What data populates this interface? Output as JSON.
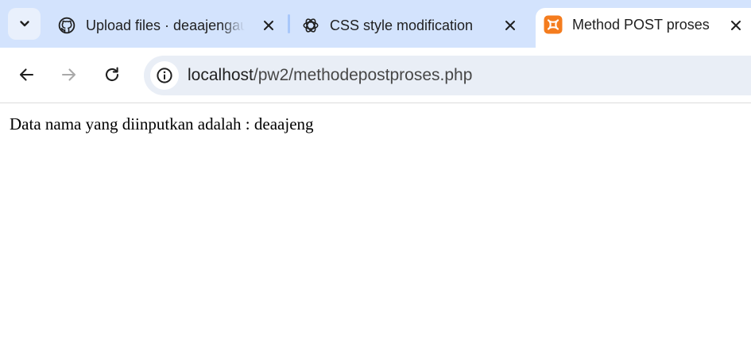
{
  "browser": {
    "tabs": [
      {
        "title": "Upload files · deaajengau",
        "favicon": "github-icon"
      },
      {
        "title": "CSS style modification",
        "favicon": "openai-icon"
      },
      {
        "title": "Method POST proses",
        "favicon": "xampp-icon",
        "active": true
      }
    ],
    "address": {
      "host": "localhost",
      "path": "/pw2/methodepostproses.php"
    }
  },
  "page": {
    "text": "Data nama yang diinputkan adalah : deaajeng"
  },
  "colors": {
    "tabstrip": "#d3e3fd",
    "omnibox": "#e9eef6",
    "xampp_orange": "#f47c1e"
  }
}
